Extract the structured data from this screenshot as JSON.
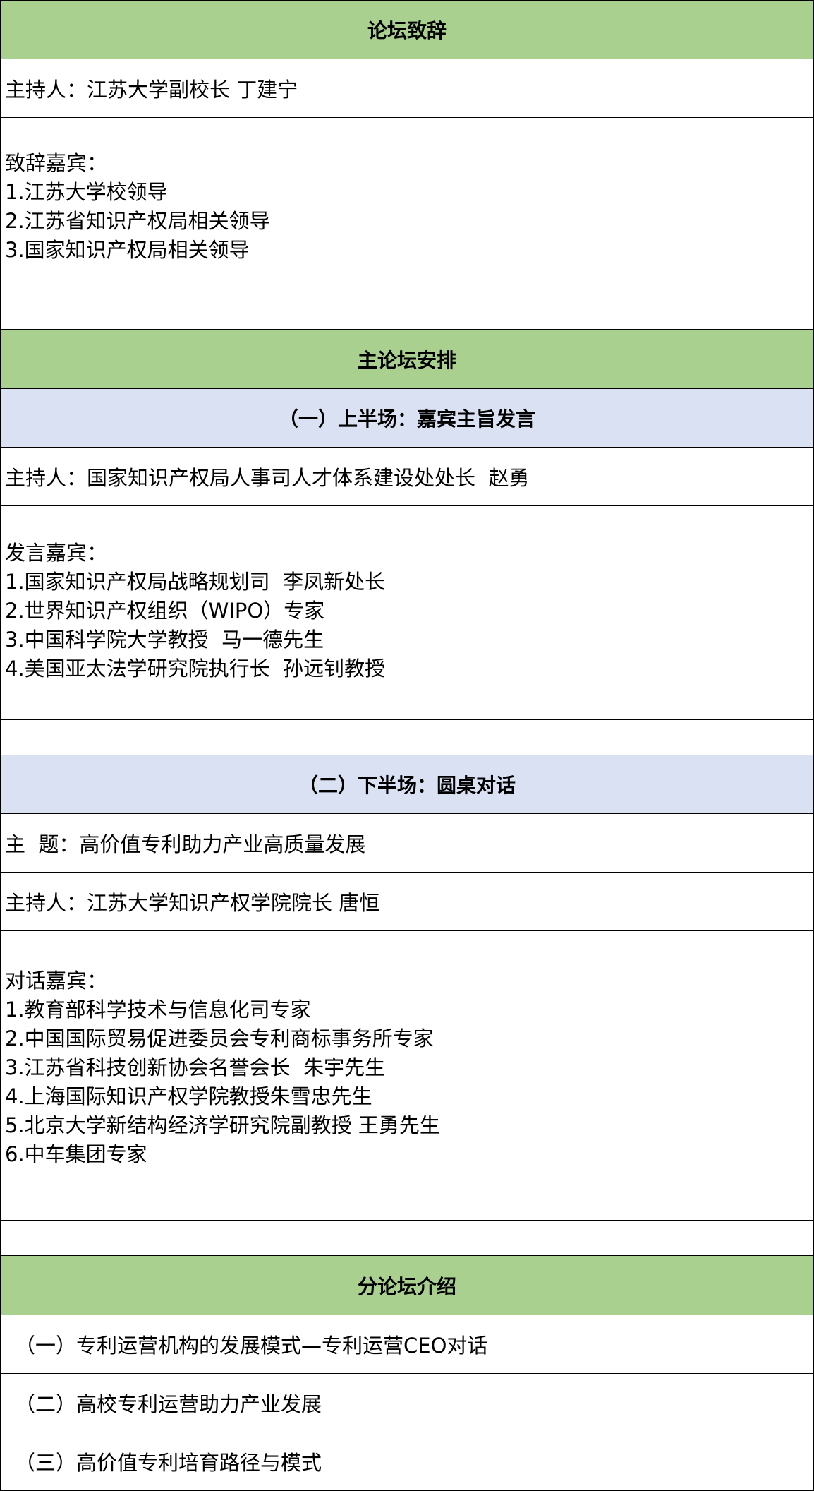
{
  "opening": {
    "header": "论坛致辞",
    "host": "主持人：江苏大学副校长 丁建宁",
    "guests_title": "致辞嘉宾：",
    "guests": [
      "1.江苏大学校领导",
      "2.江苏省知识产权局相关领导",
      "3.国家知识产权局相关领导"
    ]
  },
  "main_forum": {
    "header": "主论坛安排",
    "part1": {
      "header": "（一）上半场：嘉宾主旨发言",
      "host": "主持人：国家知识产权局人事司人才体系建设处处长  赵勇",
      "guests_title": "发言嘉宾：",
      "guests": [
        "1.国家知识产权局战略规划司  李凤新处长",
        "2.世界知识产权组织（WIPO）专家",
        "3.中国科学院大学教授  马一德先生",
        "4.美国亚太法学研究院执行长  孙远钊教授"
      ]
    },
    "part2": {
      "header": "（二）下半场：圆桌对话",
      "topic": "主  题：高价值专利助力产业高质量发展",
      "host": "主持人：江苏大学知识产权学院院长 唐恒",
      "guests_title": "对话嘉宾：",
      "guests": [
        "1.教育部科学技术与信息化司专家",
        "2.中国国际贸易促进委员会专利商标事务所专家",
        "3.江苏省科技创新协会名誉会长  朱宇先生",
        "4.上海国际知识产权学院教授朱雪忠先生",
        "5.北京大学新结构经济学研究院副教授 王勇先生",
        "6.中车集团专家"
      ]
    }
  },
  "sub_forums": {
    "header": "分论坛介绍",
    "items": [
      "（一）专利运营机构的发展模式—专利运营CEO对话",
      "（二）高校专利运营助力产业发展",
      "（三）高价值专利培育路径与模式"
    ]
  },
  "colors": {
    "header_green": "#a9d08e",
    "header_blue": "#d9e1f2",
    "border": "#000000"
  }
}
